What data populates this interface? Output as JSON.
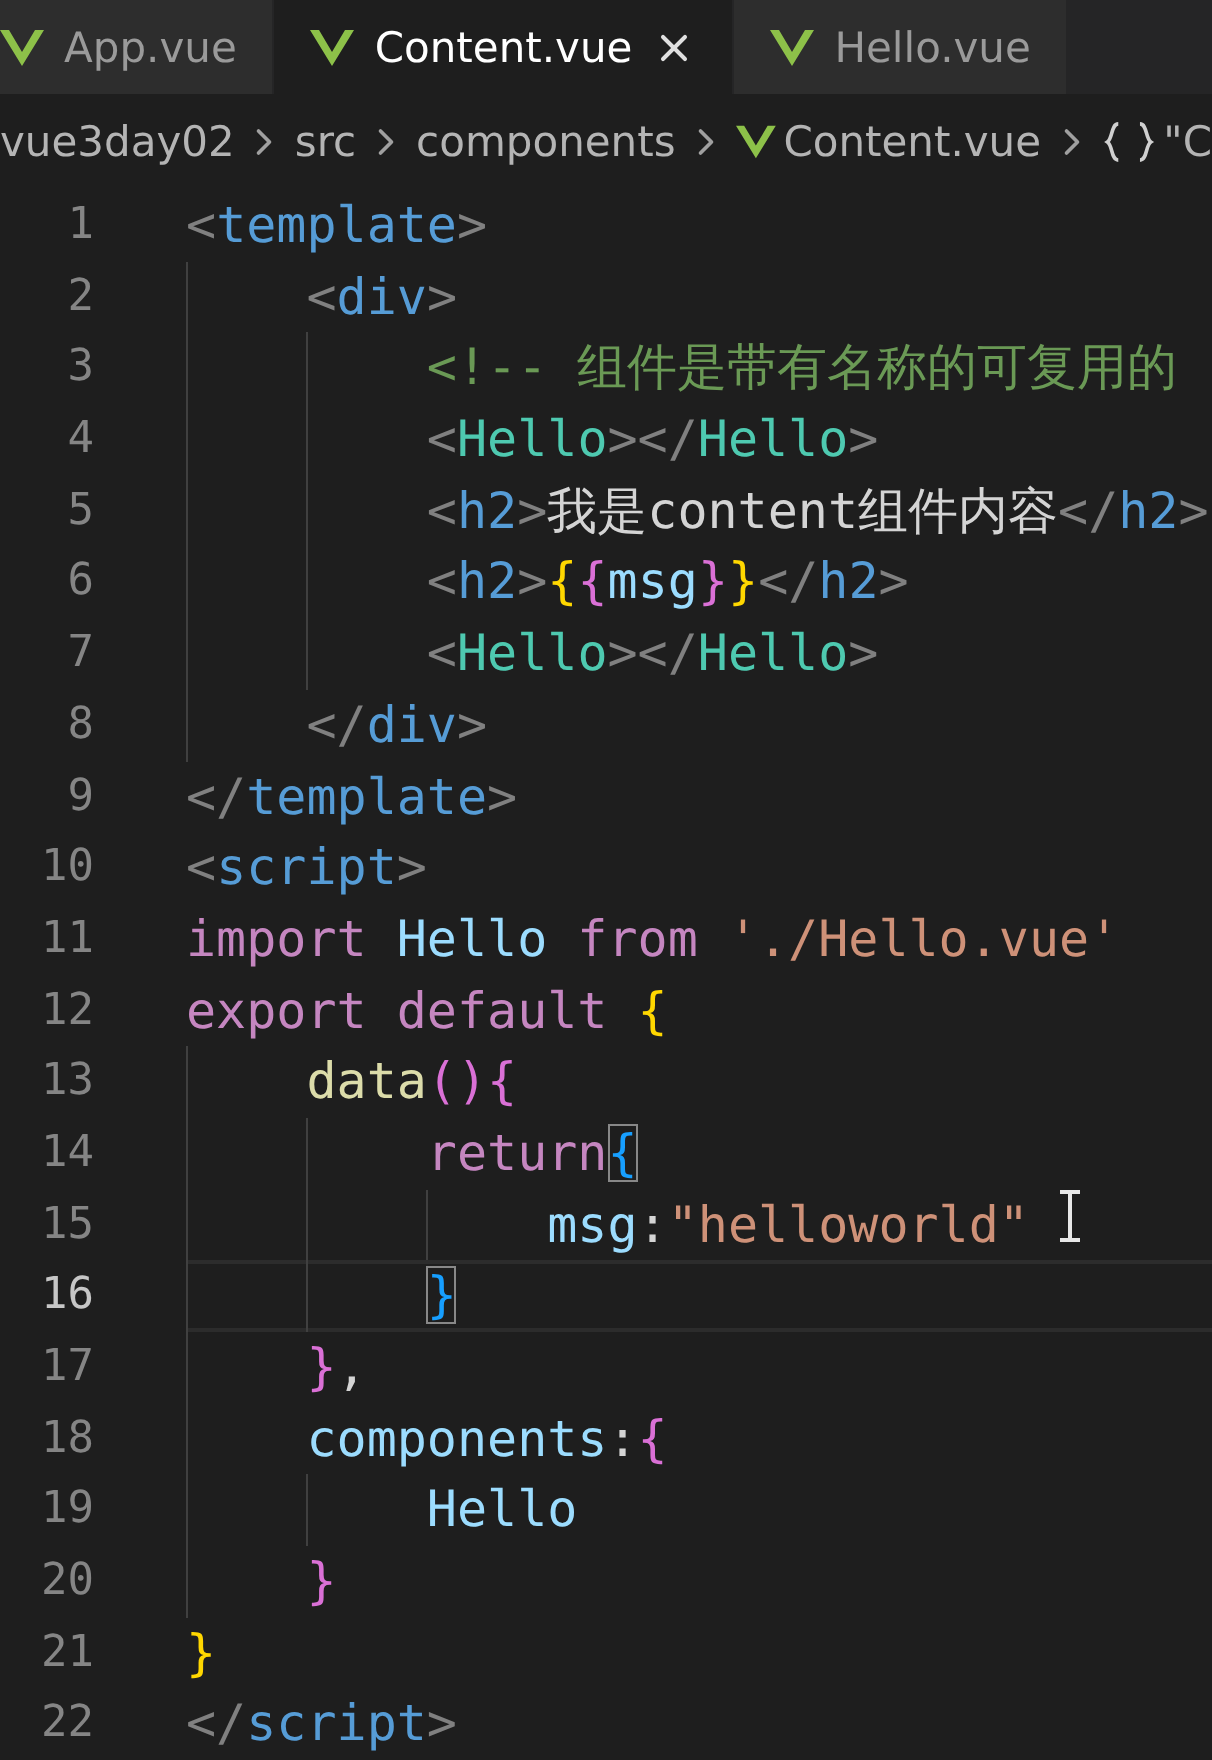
{
  "tabs": [
    {
      "label": "App.vue",
      "selected": false
    },
    {
      "label": "Content.vue",
      "selected": true
    },
    {
      "label": "Hello.vue",
      "selected": false
    }
  ],
  "breadcrumbs": [
    {
      "label": "vue3day02",
      "kind": "folder"
    },
    {
      "label": "src",
      "kind": "folder"
    },
    {
      "label": "components",
      "kind": "folder"
    },
    {
      "label": "Content.vue",
      "kind": "file"
    },
    {
      "label": "\"C",
      "kind": "symbol"
    }
  ],
  "editor": {
    "lines": [
      {
        "number": "1",
        "current": false,
        "tokens": [
          {
            "text": "<",
            "kind": "punct"
          },
          {
            "text": "template",
            "kind": "tag"
          },
          {
            "text": ">",
            "kind": "punct"
          }
        ]
      },
      {
        "number": "2",
        "current": false,
        "tokens": [
          {
            "text": "    <",
            "kind": "punct"
          },
          {
            "text": "div",
            "kind": "tag"
          },
          {
            "text": ">",
            "kind": "punct"
          }
        ]
      },
      {
        "number": "3",
        "current": false,
        "tokens": [
          {
            "text": "        <!-- 组件是带有名称的可复用的",
            "kind": "comment"
          }
        ]
      },
      {
        "number": "4",
        "current": false,
        "tokens": [
          {
            "text": "        <",
            "kind": "punct"
          },
          {
            "text": "Hello",
            "kind": "component"
          },
          {
            "text": "></",
            "kind": "punct"
          },
          {
            "text": "Hello",
            "kind": "component"
          },
          {
            "text": ">",
            "kind": "punct"
          }
        ]
      },
      {
        "number": "5",
        "current": false,
        "tokens": [
          {
            "text": "        <",
            "kind": "punct"
          },
          {
            "text": "h2",
            "kind": "tag"
          },
          {
            "text": ">",
            "kind": "punct"
          },
          {
            "text": "我是content组件内容",
            "kind": "text"
          },
          {
            "text": "</",
            "kind": "punct"
          },
          {
            "text": "h2",
            "kind": "tag"
          },
          {
            "text": ">",
            "kind": "punct"
          }
        ]
      },
      {
        "number": "6",
        "current": false,
        "tokens": [
          {
            "text": "        <",
            "kind": "punct"
          },
          {
            "text": "h2",
            "kind": "tag"
          },
          {
            "text": ">",
            "kind": "punct"
          },
          {
            "text": "{",
            "kind": "brace1"
          },
          {
            "text": "{",
            "kind": "brace2"
          },
          {
            "text": "msg",
            "kind": "var"
          },
          {
            "text": "}",
            "kind": "brace2"
          },
          {
            "text": "}",
            "kind": "brace1"
          },
          {
            "text": "</",
            "kind": "punct"
          },
          {
            "text": "h2",
            "kind": "tag"
          },
          {
            "text": ">",
            "kind": "punct"
          }
        ]
      },
      {
        "number": "7",
        "current": false,
        "tokens": [
          {
            "text": "        <",
            "kind": "punct"
          },
          {
            "text": "Hello",
            "kind": "component"
          },
          {
            "text": "></",
            "kind": "punct"
          },
          {
            "text": "Hello",
            "kind": "component"
          },
          {
            "text": ">",
            "kind": "punct"
          }
        ]
      },
      {
        "number": "8",
        "current": false,
        "tokens": [
          {
            "text": "    </",
            "kind": "punct"
          },
          {
            "text": "div",
            "kind": "tag"
          },
          {
            "text": ">",
            "kind": "punct"
          }
        ]
      },
      {
        "number": "9",
        "current": false,
        "tokens": [
          {
            "text": "</",
            "kind": "punct"
          },
          {
            "text": "template",
            "kind": "tag"
          },
          {
            "text": ">",
            "kind": "punct"
          }
        ]
      },
      {
        "number": "10",
        "current": false,
        "tokens": [
          {
            "text": "<",
            "kind": "punct"
          },
          {
            "text": "script",
            "kind": "tag"
          },
          {
            "text": ">",
            "kind": "punct"
          }
        ]
      },
      {
        "number": "11",
        "current": false,
        "tokens": [
          {
            "text": "import ",
            "kind": "keyword"
          },
          {
            "text": "Hello ",
            "kind": "var"
          },
          {
            "text": "from ",
            "kind": "keyword"
          },
          {
            "text": "'./Hello.vue'",
            "kind": "string"
          }
        ]
      },
      {
        "number": "12",
        "current": false,
        "tokens": [
          {
            "text": "export default ",
            "kind": "keyword"
          },
          {
            "text": "{",
            "kind": "brace1"
          }
        ]
      },
      {
        "number": "13",
        "current": false,
        "tokens": [
          {
            "text": "    data",
            "kind": "func"
          },
          {
            "text": "(){",
            "kind": "brace2"
          }
        ]
      },
      {
        "number": "14",
        "current": false,
        "tokens": [
          {
            "text": "        return",
            "kind": "keyword"
          },
          {
            "text": "{",
            "kind": "match"
          }
        ]
      },
      {
        "number": "15",
        "current": false,
        "tokens": [
          {
            "text": "            msg",
            "kind": "var"
          },
          {
            "text": ":",
            "kind": "text"
          },
          {
            "text": "\"helloworld\"",
            "kind": "string"
          }
        ]
      },
      {
        "number": "16",
        "current": true,
        "tokens": [
          {
            "text": "        }",
            "kind": "match"
          }
        ]
      },
      {
        "number": "17",
        "current": false,
        "tokens": [
          {
            "text": "    }",
            "kind": "brace2"
          },
          {
            "text": ",",
            "kind": "text"
          }
        ]
      },
      {
        "number": "18",
        "current": false,
        "tokens": [
          {
            "text": "    components",
            "kind": "var"
          },
          {
            "text": ":",
            "kind": "text"
          },
          {
            "text": "{",
            "kind": "brace2"
          }
        ]
      },
      {
        "number": "19",
        "current": false,
        "tokens": [
          {
            "text": "        Hello",
            "kind": "var"
          }
        ]
      },
      {
        "number": "20",
        "current": false,
        "tokens": [
          {
            "text": "    }",
            "kind": "brace2"
          }
        ]
      },
      {
        "number": "21",
        "current": false,
        "tokens": [
          {
            "text": "}",
            "kind": "brace1"
          }
        ]
      },
      {
        "number": "22",
        "current": false,
        "tokens": [
          {
            "text": "</",
            "kind": "punct"
          },
          {
            "text": "script",
            "kind": "tag"
          },
          {
            "text": ">",
            "kind": "punct"
          }
        ]
      }
    ]
  }
}
